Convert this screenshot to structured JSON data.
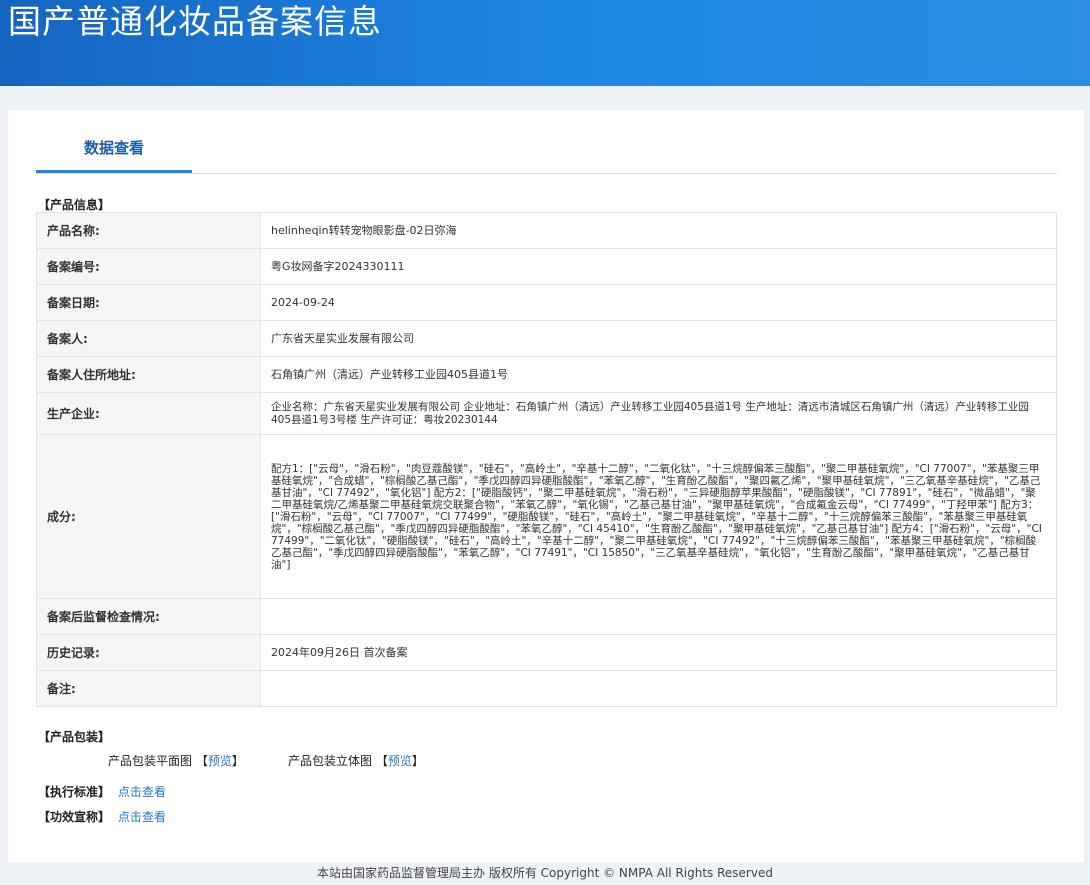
{
  "header": {
    "title": "国产普通化妆品备案信息"
  },
  "tabs": [
    {
      "label": "数据查看"
    }
  ],
  "sections": {
    "product_info": "【产品信息】",
    "product_package": "【产品包装】",
    "standard": "【执行标准】",
    "efficacy": "【功效宣称】"
  },
  "product": [
    {
      "label": "产品名称:",
      "value": "helinheqin转转宠物眼影盘-02日弥海"
    },
    {
      "label": "备案编号:",
      "value": "粤G妆网备字2024330111"
    },
    {
      "label": "备案日期:",
      "value": "2024-09-24"
    },
    {
      "label": "备案人:",
      "value": "广东省天星实业发展有限公司"
    },
    {
      "label": "备案人住所地址:",
      "value": "石角镇广州（清远）产业转移工业园405县道1号"
    },
    {
      "label": "生产企业:",
      "value": "企业名称：广东省天星实业发展有限公司 企业地址：石角镇广州（清远）产业转移工业园405县道1号 生产地址：清远市清城区石角镇广州（清远）产业转移工业园405县道1号3号楼 生产许可证：粤妆20230144"
    },
    {
      "label": "成分:",
      "value": "配方1：[\"云母\"，\"滑石粉\"，\"肉豆蔻酸镁\"，\"硅石\"，\"高岭土\"，\"辛基十二醇\"，\"二氧化钛\"，\"十三烷醇偏苯三酸酯\"，\"聚二甲基硅氧烷\"，\"CI 77007\"，\"苯基聚三甲基硅氧烷\"，\"合成蜡\"，\"棕榈酸乙基己酯\"，\"季戊四醇四异硬脂酸酯\"，\"苯氧乙醇\"，\"生育酚乙酸酯\"，\"聚四氟乙烯\"，\"聚甲基硅氧烷\"，\"三乙氧基辛基硅烷\"，\"乙基己基甘油\"，\"CI 77492\"，\"氧化铝\"] 配方2：[\"硬脂酸钙\"，\"聚二甲基硅氧烷\"，\"滑石粉\"，\"三异硬脂醇苹果酸酯\"，\"硬脂酸镁\"，\"CI 77891\"，\"硅石\"，\"微晶蜡\"，\"聚二甲基硅氧烷/乙烯基聚二甲基硅氧烷交联聚合物\"，\"苯氧乙醇\"，\"氧化锡\"，\"乙基己基甘油\"，\"聚甲基硅氧烷\"，\"合成氟金云母\"，\"CI 77499\"，\"丁羟甲苯\"] 配方3：[\"滑石粉\"，\"云母\"，\"CI 77007\"，\"CI 77499\"，\"硬脂酸镁\"，\"硅石\"，\"高岭土\"，\"聚二甲基硅氧烷\"，\"辛基十二醇\"，\"十三烷醇偏苯三酸酯\"，\"苯基聚三甲基硅氧烷\"，\"棕榈酸乙基己酯\"，\"季戊四醇四异硬脂酸酯\"，\"苯氧乙醇\"，\"CI 45410\"，\"生育酚乙酸酯\"，\"聚甲基硅氧烷\"，\"乙基己基甘油\"] 配方4：[\"滑石粉\"，\"云母\"，\"CI 77499\"，\"二氧化钛\"，\"硬脂酸镁\"，\"硅石\"，\"高岭土\"，\"辛基十二醇\"，\"聚二甲基硅氧烷\"，\"CI 77492\"，\"十三烷醇偏苯三酸酯\"，\"苯基聚三甲基硅氧烷\"，\"棕榈酸乙基己酯\"，\"季戊四醇四异硬脂酸酯\"，\"苯氧乙醇\"，\"CI 77491\"，\"CI 15850\"，\"三乙氧基辛基硅烷\"，\"氧化铝\"，\"生育酚乙酸酯\"，\"聚甲基硅氧烷\"，\"乙基己基甘油\"]"
    },
    {
      "label": "备案后监督检查情况:",
      "value": ""
    },
    {
      "label": "历史记录:",
      "value": "2024年09月26日 首次备案"
    },
    {
      "label": "备注:",
      "value": ""
    }
  ],
  "package": {
    "flat_label": "产品包装平面图",
    "solid_label": "产品包装立体图",
    "bracket_open": "【",
    "bracket_close": "】",
    "preview": "预览"
  },
  "links": {
    "view": "点击查看"
  },
  "footer": {
    "text": "本站由国家药品监督管理局主办 版权所有 Copyright © NMPA All Rights Reserved"
  }
}
